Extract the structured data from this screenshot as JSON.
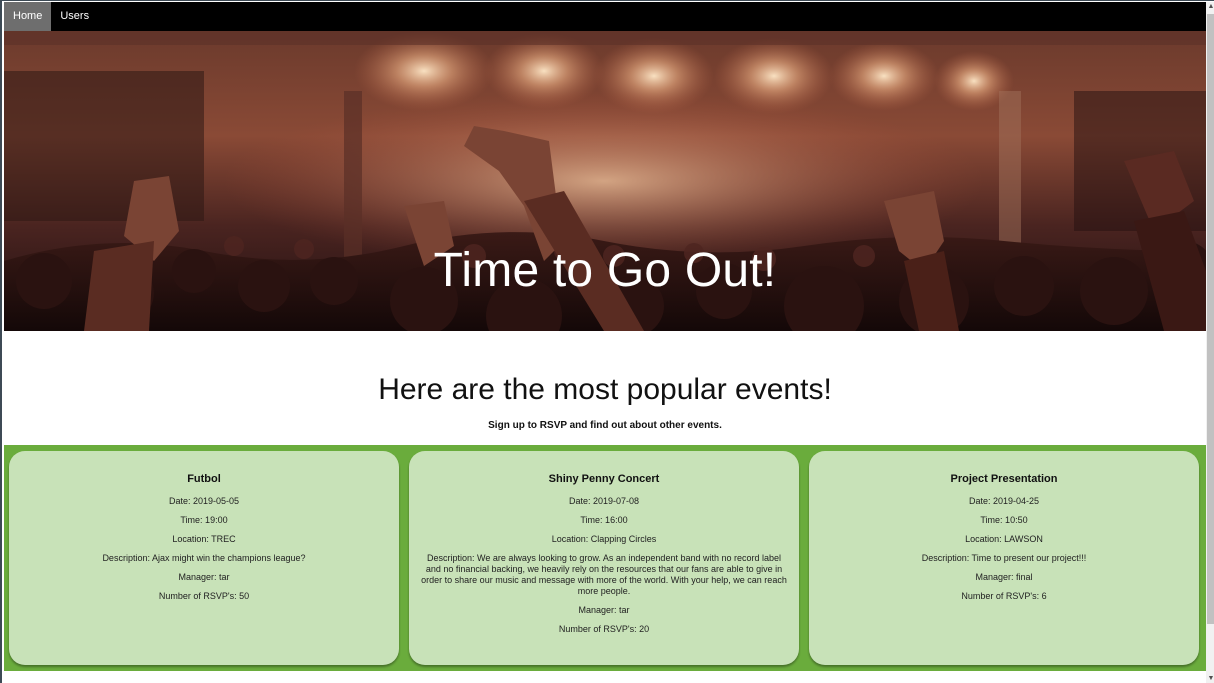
{
  "nav": {
    "items": [
      {
        "label": "Home",
        "active": true
      },
      {
        "label": "Users",
        "active": false
      }
    ]
  },
  "hero": {
    "title": "Time to Go Out!"
  },
  "section": {
    "headline": "Here are the most popular events!",
    "subline": "Sign up to RSVP and find out about other events."
  },
  "events": [
    {
      "title": "Futbol",
      "date": "Date: 2019-05-05",
      "time": "Time: 19:00",
      "location": "Location: TREC",
      "description": "Description: Ajax might win the champions league?",
      "manager": "Manager: tar",
      "rsvps": "Number of RSVP's: 50"
    },
    {
      "title": "Shiny Penny Concert",
      "date": "Date: 2019-07-08",
      "time": "Time: 16:00",
      "location": "Location: Clapping Circles",
      "description": "Description: We are always looking to grow. As an independent band with no record label and no financial backing, we heavily rely on the resources that our fans are able to give in order to share our music and message with more of the world. With your help, we can reach more people.",
      "manager": "Manager: tar",
      "rsvps": "Number of RSVP's: 20"
    },
    {
      "title": "Project Presentation",
      "date": "Date: 2019-04-25",
      "time": "Time: 10:50",
      "location": "Location: LAWSON",
      "description": "Description: Time to present our project!!!",
      "manager": "Manager: final",
      "rsvps": "Number of RSVP's: 6"
    }
  ],
  "colors": {
    "nav_bg": "#000000",
    "nav_active": "#6e6e6e",
    "events_bg": "#6aac3c",
    "card_bg": "#c8e2b8"
  }
}
